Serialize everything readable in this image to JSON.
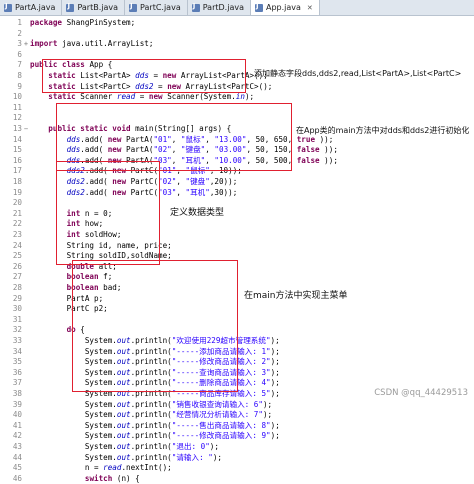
{
  "tabs": [
    {
      "label": "PartA.java",
      "active": false
    },
    {
      "label": "PartB.java",
      "active": false
    },
    {
      "label": "PartC.java",
      "active": false
    },
    {
      "label": "PartD.java",
      "active": false
    },
    {
      "label": "App.java",
      "active": true
    }
  ],
  "lines": [
    {
      "n": "1",
      "parts": [
        [
          "kw",
          "package"
        ],
        [
          "",
          "ShangPinSystem;"
        ]
      ]
    },
    {
      "n": "2",
      "parts": []
    },
    {
      "n": "3",
      "m": "+",
      "parts": [
        [
          "kw",
          "import"
        ],
        [
          "",
          "java.util.ArrayList;"
        ]
      ]
    },
    {
      "n": "6",
      "parts": []
    },
    {
      "n": "7",
      "parts": [
        [
          "kw",
          "public class"
        ],
        [
          "",
          "App {"
        ]
      ]
    },
    {
      "n": "8",
      "parts": [
        [
          "",
          "    "
        ],
        [
          "kw",
          "static"
        ],
        [
          "",
          " List<PartA> "
        ],
        [
          "fld",
          "dds"
        ],
        [
          "",
          " = "
        ],
        [
          "kw",
          "new"
        ],
        [
          "",
          " ArrayList<PartA>();"
        ]
      ]
    },
    {
      "n": "9",
      "parts": [
        [
          "",
          "    "
        ],
        [
          "kw",
          "static"
        ],
        [
          "",
          " List<PartC> "
        ],
        [
          "fld",
          "dds2"
        ],
        [
          "",
          " = "
        ],
        [
          "kw",
          "new"
        ],
        [
          "",
          " ArrayList<PartC>();"
        ]
      ]
    },
    {
      "n": "10",
      "parts": [
        [
          "",
          "    "
        ],
        [
          "kw",
          "static"
        ],
        [
          "",
          " Scanner "
        ],
        [
          "fld",
          "read"
        ],
        [
          "",
          " = "
        ],
        [
          "kw",
          "new"
        ],
        [
          "",
          " Scanner(System."
        ],
        [
          "fld",
          "in"
        ],
        [
          "",
          ");"
        ]
      ]
    },
    {
      "n": "11",
      "parts": []
    },
    {
      "n": "12",
      "parts": []
    },
    {
      "n": "13",
      "m": "−",
      "parts": [
        [
          "",
          "    "
        ],
        [
          "kw",
          "public static void"
        ],
        [
          "",
          " main(String[] args) {"
        ]
      ]
    },
    {
      "n": "14",
      "parts": [
        [
          "",
          "        "
        ],
        [
          "fld",
          "dds"
        ],
        [
          "",
          ".add("
        ],
        [
          "kw",
          "new"
        ],
        [
          "",
          " PartA("
        ],
        [
          "str",
          "\"01\""
        ],
        [
          "",
          ", "
        ],
        [
          "str",
          "\"鼠标\""
        ],
        [
          "",
          ", "
        ],
        [
          "str",
          "\"13.00\""
        ],
        [
          "",
          ", 50, 650, "
        ],
        [
          "kw",
          "true"
        ],
        [
          "",
          "));"
        ]
      ]
    },
    {
      "n": "15",
      "parts": [
        [
          "",
          "        "
        ],
        [
          "fld",
          "dds"
        ],
        [
          "",
          ".add("
        ],
        [
          "kw",
          "new"
        ],
        [
          "",
          " PartA("
        ],
        [
          "str",
          "\"02\""
        ],
        [
          "",
          ", "
        ],
        [
          "str",
          "\"键盘\""
        ],
        [
          "",
          ", "
        ],
        [
          "str",
          "\"03.00\""
        ],
        [
          "",
          ", 50, 150, "
        ],
        [
          "kw",
          "false"
        ],
        [
          "",
          "));"
        ]
      ]
    },
    {
      "n": "16",
      "parts": [
        [
          "",
          "        "
        ],
        [
          "fld",
          "dds"
        ],
        [
          "",
          ".add("
        ],
        [
          "kw",
          "new"
        ],
        [
          "",
          " PartA("
        ],
        [
          "str",
          "\"03\""
        ],
        [
          "",
          ", "
        ],
        [
          "str",
          "\"耳机\""
        ],
        [
          "",
          ", "
        ],
        [
          "str",
          "\"10.00\""
        ],
        [
          "",
          ", 50, 500, "
        ],
        [
          "kw",
          "false"
        ],
        [
          "",
          "));"
        ]
      ]
    },
    {
      "n": "17",
      "parts": [
        [
          "",
          "        "
        ],
        [
          "fld",
          "dds2"
        ],
        [
          "",
          ".add("
        ],
        [
          "kw",
          "new"
        ],
        [
          "",
          " PartC("
        ],
        [
          "str",
          "\"01\""
        ],
        [
          "",
          ", "
        ],
        [
          "str",
          "\"鼠标\""
        ],
        [
          "",
          ", 10));"
        ]
      ]
    },
    {
      "n": "18",
      "parts": [
        [
          "",
          "        "
        ],
        [
          "fld",
          "dds2"
        ],
        [
          "",
          ".add("
        ],
        [
          "kw",
          "new"
        ],
        [
          "",
          " PartC("
        ],
        [
          "str",
          "\"02\""
        ],
        [
          "",
          ", "
        ],
        [
          "str",
          "\"键盘\""
        ],
        [
          "",
          ",20));"
        ]
      ]
    },
    {
      "n": "19",
      "parts": [
        [
          "",
          "        "
        ],
        [
          "fld",
          "dds2"
        ],
        [
          "",
          ".add("
        ],
        [
          "kw",
          "new"
        ],
        [
          "",
          " PartC("
        ],
        [
          "str",
          "\"03\""
        ],
        [
          "",
          ", "
        ],
        [
          "str",
          "\"耳机\""
        ],
        [
          "",
          ",30));"
        ]
      ]
    },
    {
      "n": "20",
      "parts": []
    },
    {
      "n": "21",
      "parts": [
        [
          "",
          "        "
        ],
        [
          "kw",
          "int"
        ],
        [
          "",
          " n = 0;"
        ]
      ]
    },
    {
      "n": "22",
      "parts": [
        [
          "",
          "        "
        ],
        [
          "kw",
          "int"
        ],
        [
          "",
          " how;"
        ]
      ]
    },
    {
      "n": "23",
      "parts": [
        [
          "",
          "        "
        ],
        [
          "kw",
          "int"
        ],
        [
          "",
          " soldHow;"
        ]
      ]
    },
    {
      "n": "24",
      "parts": [
        [
          "",
          "        String id, name, price;"
        ]
      ]
    },
    {
      "n": "25",
      "parts": [
        [
          "",
          "        String soldID,soldName;"
        ]
      ]
    },
    {
      "n": "26",
      "parts": [
        [
          "",
          "        "
        ],
        [
          "kw",
          "double"
        ],
        [
          "",
          " all;"
        ]
      ]
    },
    {
      "n": "27",
      "parts": [
        [
          "",
          "        "
        ],
        [
          "kw",
          "boolean"
        ],
        [
          "",
          " f;"
        ]
      ]
    },
    {
      "n": "28",
      "parts": [
        [
          "",
          "        "
        ],
        [
          "kw",
          "boolean"
        ],
        [
          "",
          " bad;"
        ]
      ]
    },
    {
      "n": "29",
      "parts": [
        [
          "",
          "        PartA p;"
        ]
      ]
    },
    {
      "n": "30",
      "parts": [
        [
          "",
          "        PartC p2;"
        ]
      ]
    },
    {
      "n": "31",
      "parts": []
    },
    {
      "n": "32",
      "parts": [
        [
          "",
          "        "
        ],
        [
          "kw",
          "do"
        ],
        [
          "",
          " {"
        ]
      ]
    },
    {
      "n": "33",
      "parts": [
        [
          "",
          "            System."
        ],
        [
          "fld",
          "out"
        ],
        [
          "",
          ".println("
        ],
        [
          "str",
          "\"欢迎使用229超市管理系统\""
        ],
        [
          "",
          ");"
        ]
      ]
    },
    {
      "n": "34",
      "parts": [
        [
          "",
          "            System."
        ],
        [
          "fld",
          "out"
        ],
        [
          "",
          ".println("
        ],
        [
          "str",
          "\"-----添加商品请输入: 1\""
        ],
        [
          "",
          ");"
        ]
      ]
    },
    {
      "n": "35",
      "parts": [
        [
          "",
          "            System."
        ],
        [
          "fld",
          "out"
        ],
        [
          "",
          ".println("
        ],
        [
          "str",
          "\"-----修改商品请输入: 2\""
        ],
        [
          "",
          ");"
        ]
      ]
    },
    {
      "n": "36",
      "parts": [
        [
          "",
          "            System."
        ],
        [
          "fld",
          "out"
        ],
        [
          "",
          ".println("
        ],
        [
          "str",
          "\"-----查询商品请输入: 3\""
        ],
        [
          "",
          ");"
        ]
      ]
    },
    {
      "n": "37",
      "parts": [
        [
          "",
          "            System."
        ],
        [
          "fld",
          "out"
        ],
        [
          "",
          ".println("
        ],
        [
          "str",
          "\"-----删除商品请输入: 4\""
        ],
        [
          "",
          ");"
        ]
      ]
    },
    {
      "n": "38",
      "parts": [
        [
          "",
          "            System."
        ],
        [
          "fld",
          "out"
        ],
        [
          "",
          ".println("
        ],
        [
          "str",
          "\"-----商品库存请输入: 5\""
        ],
        [
          "",
          ");"
        ]
      ]
    },
    {
      "n": "39",
      "parts": [
        [
          "",
          "            System."
        ],
        [
          "fld",
          "out"
        ],
        [
          "",
          ".println("
        ],
        [
          "str",
          "\"销售收银查询请输入: 6\""
        ],
        [
          "",
          ");"
        ]
      ]
    },
    {
      "n": "40",
      "parts": [
        [
          "",
          "            System."
        ],
        [
          "fld",
          "out"
        ],
        [
          "",
          ".println("
        ],
        [
          "str",
          "\"经营情况分析请输入: 7\""
        ],
        [
          "",
          ");"
        ]
      ]
    },
    {
      "n": "41",
      "parts": [
        [
          "",
          "            System."
        ],
        [
          "fld",
          "out"
        ],
        [
          "",
          ".println("
        ],
        [
          "str",
          "\"-----售出商品请输入: 8\""
        ],
        [
          "",
          ");"
        ]
      ]
    },
    {
      "n": "42",
      "parts": [
        [
          "",
          "            System."
        ],
        [
          "fld",
          "out"
        ],
        [
          "",
          ".println("
        ],
        [
          "str",
          "\"-----修改商品请输入: 9\""
        ],
        [
          "",
          ");"
        ]
      ]
    },
    {
      "n": "43",
      "parts": [
        [
          "",
          "            System."
        ],
        [
          "fld",
          "out"
        ],
        [
          "",
          ".println("
        ],
        [
          "str",
          "\"退出: 0\""
        ],
        [
          "",
          ");"
        ]
      ]
    },
    {
      "n": "44",
      "parts": [
        [
          "",
          "            System."
        ],
        [
          "fld",
          "out"
        ],
        [
          "",
          ".println("
        ],
        [
          "str",
          "\"请输入: \""
        ],
        [
          "",
          ");"
        ]
      ]
    },
    {
      "n": "45",
      "parts": [
        [
          "",
          "            n = "
        ],
        [
          "fld",
          "read"
        ],
        [
          "",
          ".nextInt();"
        ]
      ]
    },
    {
      "n": "46",
      "parts": [
        [
          "",
          "            "
        ],
        [
          "kw",
          "switch"
        ],
        [
          "",
          " (n) {"
        ]
      ]
    }
  ],
  "annotations": {
    "static_fields": "添加静态字段dds,dds2,read,List<PartA>,List<PartC>",
    "init": "在App类的main方法中对dds和dds2进行初始化",
    "vars": "定义数据类型",
    "menu": "在main方法中实现主菜单"
  },
  "watermark": "CSDN @qq_44429513",
  "colors": {
    "keyword": "#7f0055",
    "field": "#0000c0",
    "string": "#2a00ff",
    "highlight_box": "#e02030"
  }
}
